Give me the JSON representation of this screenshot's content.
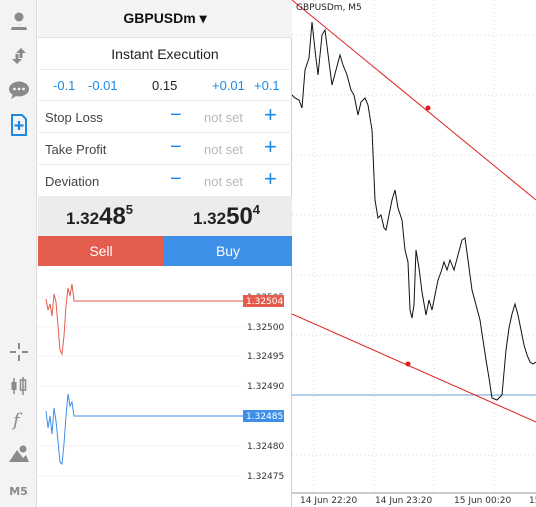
{
  "sidebar": {
    "items": [
      {
        "name": "account-icon",
        "active": false
      },
      {
        "name": "transfer-icon",
        "active": false
      },
      {
        "name": "chat-icon",
        "active": false
      },
      {
        "name": "new-order-icon",
        "active": true
      },
      {
        "name": "crosshair-icon",
        "active": false
      },
      {
        "name": "candlestick-icon",
        "active": false
      },
      {
        "name": "indicator-icon",
        "active": false
      },
      {
        "name": "objects-icon",
        "active": false
      }
    ],
    "timeframe": "M5"
  },
  "order": {
    "symbol": "GBPUSDm ▾",
    "execution": "Instant Execution",
    "volume": {
      "minus_large": "-0.1",
      "minus_small": "-0.01",
      "value": "0.15",
      "plus_small": "+0.01",
      "plus_large": "+0.1"
    },
    "params": [
      {
        "label": "Stop Loss",
        "value": "not set"
      },
      {
        "label": "Take Profit",
        "value": "not set"
      },
      {
        "label": "Deviation",
        "value": "not set"
      }
    ],
    "minus": "−",
    "plus": "+",
    "bid": {
      "big": "1.32",
      "main": "48",
      "small": "5"
    },
    "ask": {
      "big": "1.32",
      "main": "50",
      "small": "4"
    },
    "sell_label": "Sell",
    "buy_label": "Buy"
  },
  "mini_chart": {
    "price_axis": [
      "1.32505",
      "1.32500",
      "1.32495",
      "1.32490",
      "1.32480",
      "1.32475"
    ],
    "sell_price": "1.32504",
    "buy_price": "1.32485",
    "colors": {
      "sell": "#e35c4e",
      "buy": "#3d8fe8"
    }
  },
  "chart": {
    "title": "GBPUSDm, M5",
    "time_labels": [
      "14 Jun 22:20",
      "14 Jun 23:20",
      "15 Jun 00:20",
      "15"
    ],
    "line_color": "#111111",
    "trendline_color": "#e0201f"
  }
}
